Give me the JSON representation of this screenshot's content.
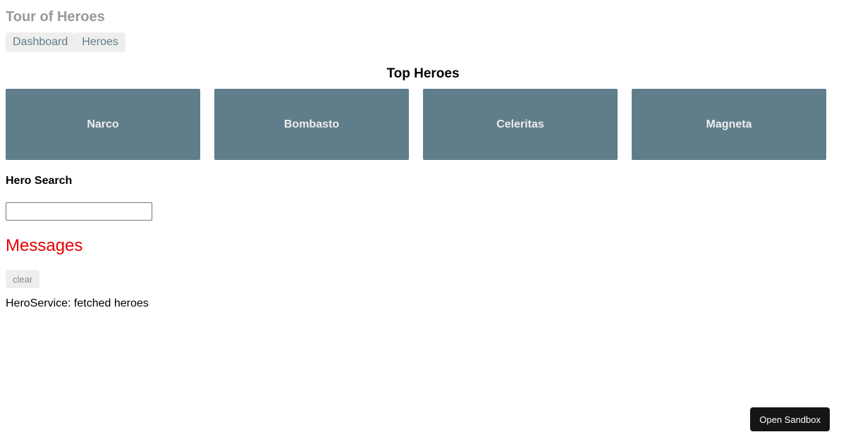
{
  "app": {
    "title": "Tour of Heroes"
  },
  "nav": {
    "items": [
      {
        "label": "Dashboard"
      },
      {
        "label": "Heroes"
      }
    ]
  },
  "dashboard": {
    "title": "Top Heroes",
    "heroes": [
      {
        "name": "Narco"
      },
      {
        "name": "Bombasto"
      },
      {
        "name": "Celeritas"
      },
      {
        "name": "Magneta"
      }
    ]
  },
  "search": {
    "title": "Hero Search",
    "value": ""
  },
  "messages": {
    "title": "Messages",
    "clear_label": "clear",
    "items": [
      {
        "text": "HeroService: fetched heroes"
      }
    ]
  },
  "sandbox": {
    "label": "Open Sandbox"
  },
  "colors": {
    "hero_card_bg": "#607d8b",
    "messages_title": "#e60000",
    "nav_text": "#607d8b"
  }
}
